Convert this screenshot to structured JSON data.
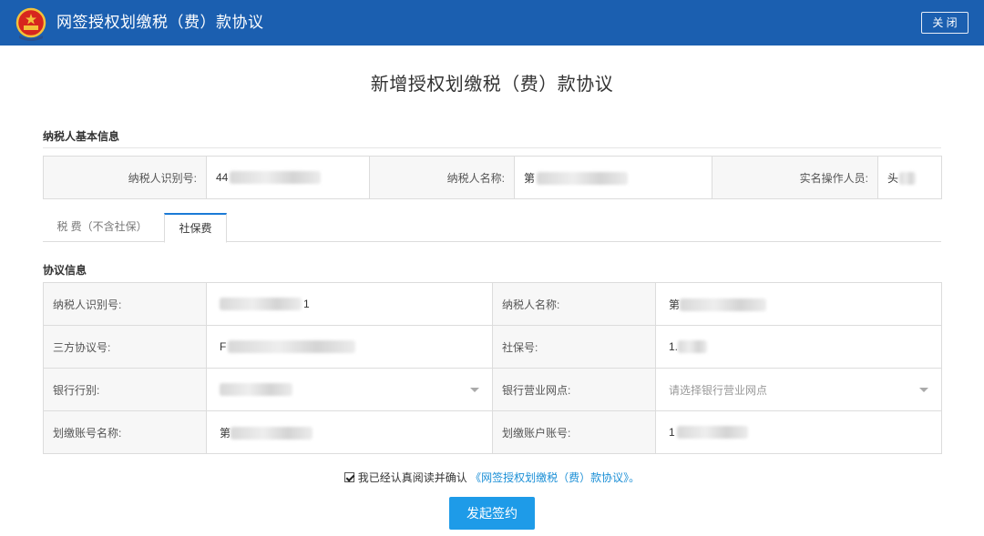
{
  "header": {
    "app_title": "网签授权划缴税（费）款协议",
    "close_label": "关 闭",
    "emblem_icon": "national-emblem-icon",
    "bg_color": "#1b5fb0"
  },
  "page_title": "新增授权划缴税（费）款协议",
  "basic_info": {
    "heading": "纳税人基本信息",
    "taxpayer_id_label": "纳税人识别号:",
    "taxpayer_id_value": "44",
    "taxpayer_name_label": "纳税人名称:",
    "taxpayer_name_value": "第",
    "operator_label": "实名操作人员:",
    "operator_value": "头"
  },
  "tabs": [
    {
      "label": "税 费（不含社保）",
      "active": false
    },
    {
      "label": "社保费",
      "active": true
    }
  ],
  "protocol_info": {
    "heading": "协议信息",
    "taxpayer_id_label": "纳税人识别号:",
    "taxpayer_id_value": "1",
    "taxpayer_name_label": "纳税人名称:",
    "taxpayer_name_value": "第",
    "tripartite_label": "三方协议号:",
    "tripartite_value": "F",
    "social_no_label": "社保号:",
    "social_no_value": "1.",
    "bank_type_label": "银行行别:",
    "bank_type_value": "",
    "bank_branch_label": "银行营业网点:",
    "bank_branch_placeholder": "请选择银行营业网点",
    "account_name_label": "划缴账号名称:",
    "account_name_value": "第",
    "account_no_label": "划缴账户账号:",
    "account_no_value": "1"
  },
  "agreement": {
    "checked": true,
    "text": "我已经认真阅读并确认",
    "link_text": "《网签授权划缴税（费）款协议》",
    "suffix": "。"
  },
  "submit_label": "发起签约",
  "colors": {
    "accent": "#1e9be8",
    "link": "#1b8fd6"
  }
}
